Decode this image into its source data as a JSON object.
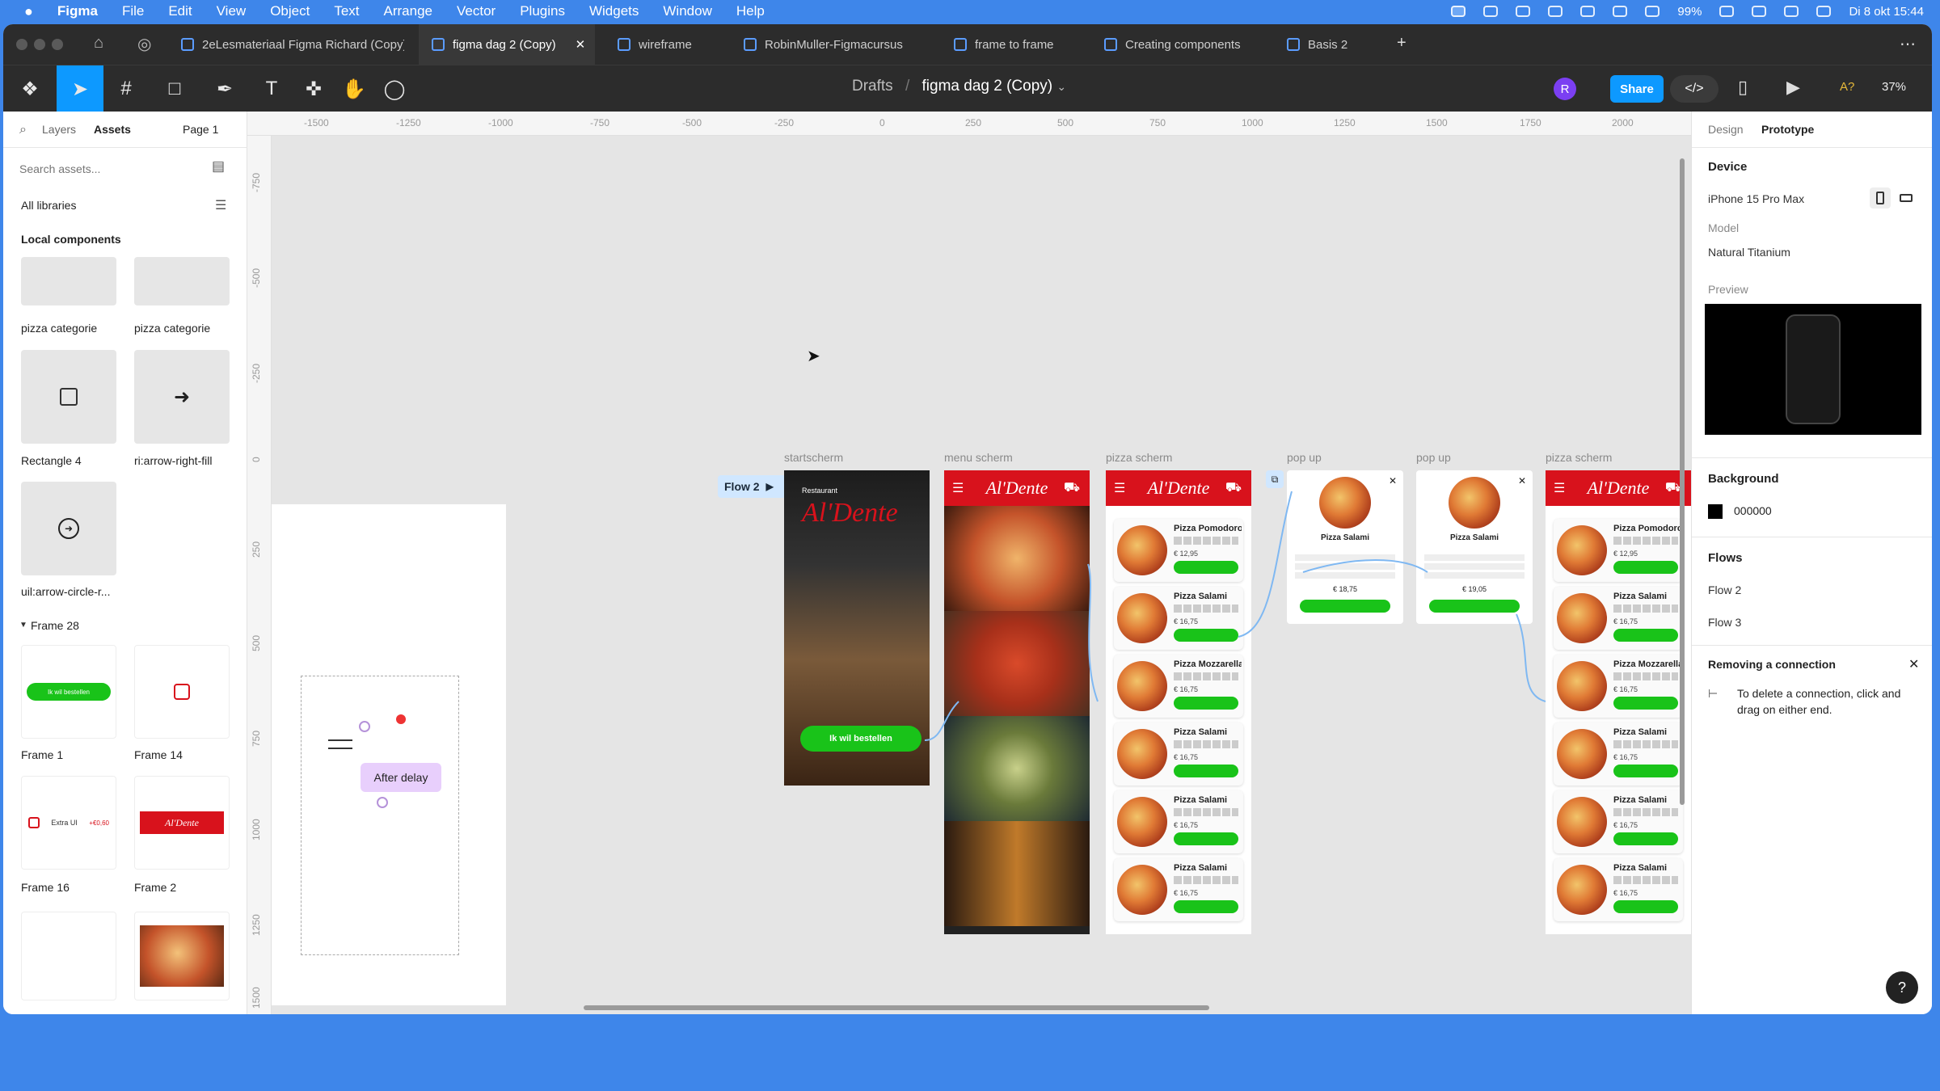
{
  "menubar": {
    "app": "Figma",
    "items": [
      "File",
      "Edit",
      "View",
      "Object",
      "Text",
      "Arrange",
      "Vector",
      "Plugins",
      "Widgets",
      "Window",
      "Help"
    ],
    "battery": "99%",
    "clock": "Di 8 okt  15:44"
  },
  "tabs": [
    {
      "label": "2eLesmateriaal Figma Richard (Copy)"
    },
    {
      "label": "figma dag 2 (Copy)"
    },
    {
      "label": "wireframe"
    },
    {
      "label": "RobinMuller-Figmacursus"
    },
    {
      "label": "frame to frame"
    },
    {
      "label": "Creating components"
    },
    {
      "label": "Basis 2"
    }
  ],
  "toolbar": {
    "breadcrumb_parent": "Drafts",
    "breadcrumb_sep": "/",
    "file_name": "figma dag 2 (Copy)",
    "avatar": "R",
    "share_label": "Share",
    "aa_label": "A?",
    "zoom": "37%"
  },
  "left": {
    "tab_layers": "Layers",
    "tab_assets": "Assets",
    "page": "Page 1",
    "search_placeholder": "Search assets...",
    "libraries": "All libraries",
    "section_local": "Local components",
    "assets": [
      {
        "label": "pizza categorie"
      },
      {
        "label": "pizza categorie"
      },
      {
        "label": "Rectangle 4"
      },
      {
        "label": "ri:arrow-right-fill"
      },
      {
        "label": "uil:arrow-circle-r..."
      }
    ],
    "group": "Frame 28",
    "frames": [
      {
        "label": "Frame 1",
        "btn_text": "Ik wil bestellen"
      },
      {
        "label": "Frame 14"
      },
      {
        "label": "Frame 16",
        "text": "Extra UI",
        "price": "+€0,60"
      },
      {
        "label": "Frame 2",
        "logo": "Al'Dente"
      }
    ]
  },
  "rulers": {
    "top": [
      "-1500",
      "-1250",
      "-1000",
      "-750",
      "-500",
      "-250",
      "0",
      "250",
      "500",
      "750",
      "1000",
      "1250",
      "1500",
      "1750",
      "2000"
    ],
    "left": [
      "-750",
      "-500",
      "-250",
      "0",
      "250",
      "500",
      "750",
      "1000",
      "1250",
      "1500"
    ]
  },
  "canvas": {
    "flow_label": "Flow 2",
    "after_delay": "After delay",
    "frames": {
      "start": {
        "label": "startscherm",
        "kicker": "Restaurant",
        "logo": "Al'Dente",
        "button": "Ik wil bestellen"
      },
      "menu": {
        "label": "menu scherm",
        "logo": "Al'Dente"
      },
      "pizza1": {
        "label": "pizza scherm",
        "logo": "Al'Dente"
      },
      "popup1": {
        "label": "pop up",
        "title": "Pizza Salami",
        "price": "€ 18,75"
      },
      "popup2": {
        "label": "pop up",
        "title": "Pizza Salami",
        "price": "€ 19,05"
      },
      "pizza2": {
        "label": "pizza scherm",
        "logo": "Al'Dente"
      }
    },
    "pizzas": [
      {
        "name": "Pizza Pomodoro",
        "price": "€ 12,95"
      },
      {
        "name": "Pizza Salami",
        "price": "€ 16,75"
      },
      {
        "name": "Pizza Mozzarella",
        "price": "€ 16,75"
      },
      {
        "name": "Pizza Salami",
        "price": "€ 16,75"
      },
      {
        "name": "Pizza Salami",
        "price": "€ 16,75"
      },
      {
        "name": "Pizza Salami",
        "price": "€ 16,75"
      }
    ]
  },
  "right": {
    "tab_design": "Design",
    "tab_prototype": "Prototype",
    "device_heading": "Device",
    "device": "iPhone 15 Pro Max",
    "model_label": "Model",
    "model": "Natural Titanium",
    "preview_label": "Preview",
    "background_heading": "Background",
    "background_value": "000000",
    "background_color": "#000000",
    "flows_heading": "Flows",
    "flows": [
      "Flow 2",
      "Flow 3"
    ],
    "tip_heading": "Removing a connection",
    "tip_text": "To delete a connection, click and drag on either end."
  },
  "colors": {
    "accent": "#0d99ff",
    "brand_red": "#d8121c",
    "cta_green": "#19c319",
    "desktop": "#3e86ea"
  }
}
